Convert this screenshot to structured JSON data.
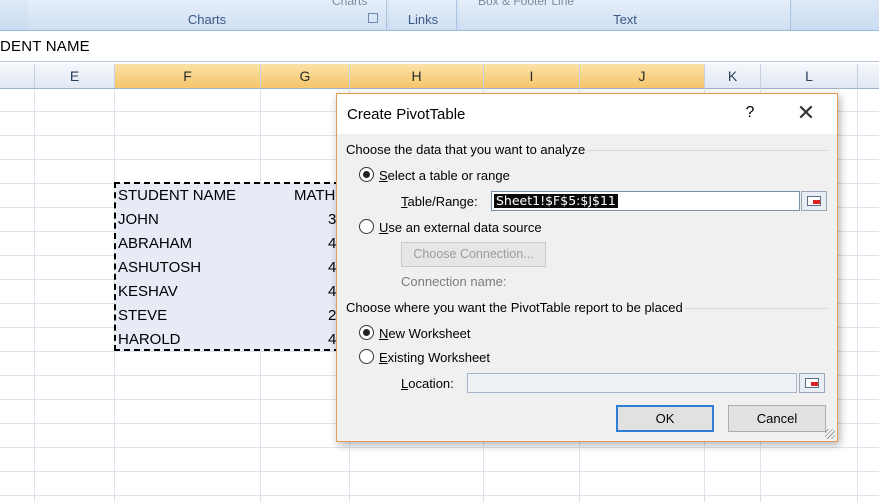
{
  "ribbon": {
    "groups": [
      {
        "cut_label": "Charts",
        "label": "Charts"
      },
      {
        "cut_label": "",
        "label": "Links"
      },
      {
        "cut_label": "Box    & Footer                    Line",
        "label": "Text"
      }
    ]
  },
  "formula_bar": {
    "text": "DENT NAME"
  },
  "columns": [
    "E",
    "F",
    "G",
    "H",
    "I",
    "J",
    "K",
    "L"
  ],
  "sheet": {
    "header_name": "STUDENT NAME",
    "header_math": "MATH",
    "rows": [
      {
        "name": "JOHN",
        "math": "3"
      },
      {
        "name": "ABRAHAM",
        "math": "4"
      },
      {
        "name": "ASHUTOSH",
        "math": "4"
      },
      {
        "name": "KESHAV",
        "math": "4"
      },
      {
        "name": "STEVE",
        "math": "2"
      },
      {
        "name": "HAROLD",
        "math": "4"
      }
    ]
  },
  "dialog": {
    "title": "Create PivotTable",
    "help": "?",
    "close": "✕",
    "section1": "Choose the data that you want to analyze",
    "opt_select_prefix": "",
    "opt_select_u": "S",
    "opt_select_rest": "elect a table or range",
    "table_range_u": "T",
    "table_range_rest": "able/Range:",
    "table_range_value": "Sheet1!$F$5:$J$11",
    "opt_external_u": "U",
    "opt_external_rest": "se an external data source",
    "choose_connection": "Choose Connection...",
    "connection_name": "Connection name:",
    "section2": "Choose where you want the PivotTable report to be placed",
    "opt_new_u": "N",
    "opt_new_rest": "ew Worksheet",
    "opt_existing_u": "E",
    "opt_existing_rest": "xisting Worksheet",
    "location_u": "L",
    "location_rest": "ocation:",
    "location_value": "",
    "ok": "OK",
    "cancel": "Cancel"
  }
}
